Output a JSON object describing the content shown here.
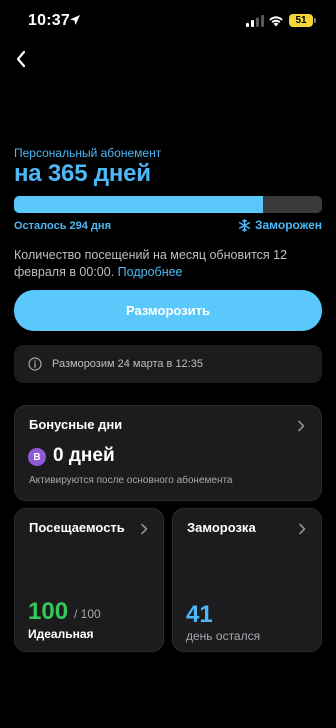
{
  "status_bar": {
    "time": "10:37",
    "battery": "51"
  },
  "membership": {
    "subtitle": "Персональный абонемент",
    "title": "на 365 дней",
    "progress": 0.81,
    "remaining": "Осталось 294 дня",
    "frozen_status": "Заморожен"
  },
  "info": {
    "text": "Количество посещений на месяц обновится 12 февраля в 00:00.",
    "link": "Подробнее"
  },
  "unfreeze_button": "Разморозить",
  "notice": "Разморозим 24 марта в 12:35",
  "bonus": {
    "title": "Бонусные дни",
    "badge": "B",
    "days": "0 дней",
    "note": "Активируются после основного абонемента"
  },
  "attendance": {
    "title": "Посещаемость",
    "value": "100",
    "total": "/ 100",
    "label": "Идеальная"
  },
  "freeze": {
    "title": "Заморозка",
    "value": "41",
    "label": "день остался"
  },
  "colors": {
    "accent": "#4db8f5",
    "button": "#5ac8fa",
    "success": "#34c759",
    "badge": "#8e5bd2"
  }
}
